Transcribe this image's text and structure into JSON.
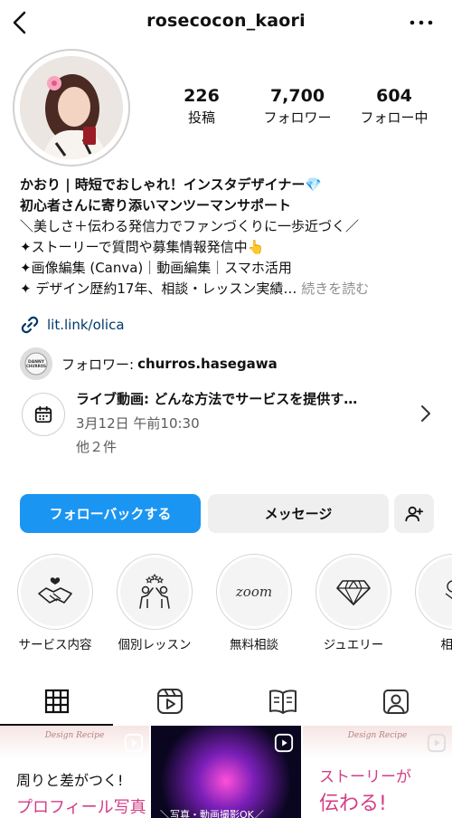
{
  "header": {
    "username": "rosecocon_kaori"
  },
  "stats": [
    {
      "value": "226",
      "label": "投稿"
    },
    {
      "value": "7,700",
      "label": "フォロワー"
    },
    {
      "value": "604",
      "label": "フォロー中"
    }
  ],
  "bio": {
    "line1": "かおり | 時短でおしゃれ！インスタデザイナー💎",
    "line2": "初心者さんに寄り添いマンツーマンサポート",
    "line3": "＼美しさ＋伝わる発信力でファンづくりに一歩近づく／",
    "line4": "✦ストーリーで質問や募集情報発信中👆",
    "line5": "✦画像編集 (Canva)｜動画編集｜スマホ活用",
    "line6": "✦ デザイン歴約17年、相談・レッスン実績… ",
    "more": "続きを読む"
  },
  "link": {
    "text": "lit.link/olica"
  },
  "followed_by": {
    "prefix": "フォロワー: ",
    "name": "churros.hasegawa",
    "avatar_text": "DANNY CHURROS"
  },
  "event": {
    "title": "ライブ動画: どんな方法でサービスを提供す…",
    "date": "3月12日 午前10:30",
    "more": "他２件"
  },
  "buttons": {
    "follow_back": "フォローバックする",
    "message": "メッセージ"
  },
  "highlights": [
    {
      "label": "サービス内容",
      "icon": "handshake-heart-icon"
    },
    {
      "label": "個別レッスン",
      "icon": "people-stars-icon"
    },
    {
      "label": "無料相談",
      "icon": "zoom-text",
      "text": "zoom"
    },
    {
      "label": "ジュエリー",
      "icon": "diamond-icon"
    },
    {
      "label": "相談",
      "icon": "flower-icon"
    }
  ],
  "tabs": [
    "grid-icon",
    "reels-icon",
    "guides-icon",
    "tagged-icon"
  ],
  "posts": [
    {
      "brand": "Design Recipe",
      "line1": "周りと差がつく!",
      "line2": "プロフィール写真"
    },
    {
      "caption": "＼写真・動画撮影OK／"
    },
    {
      "brand": "Design Recipe",
      "line1": "ストーリーが",
      "line2": "伝わる!"
    }
  ],
  "colors": {
    "primary_blue": "#1b95f2",
    "link_blue": "#00376b",
    "pink": "#d33e87"
  }
}
